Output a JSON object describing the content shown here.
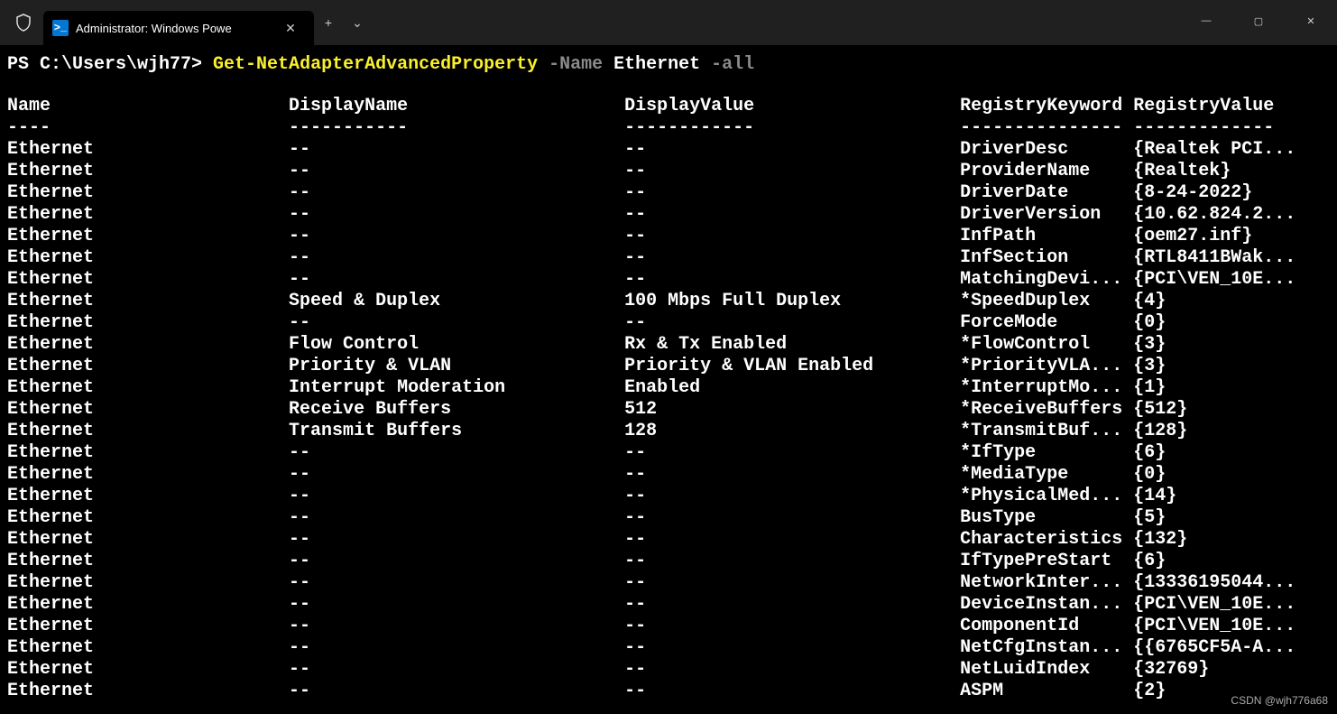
{
  "titlebar": {
    "tab_title": "Administrator: Windows Powe",
    "tab_icon_label": ">_",
    "add_label": "+",
    "chevron_label": "⌄",
    "close_tab_label": "✕",
    "minimize": "—",
    "maximize": "▢",
    "close": "✕"
  },
  "command": {
    "prompt": "PS C:\\Users\\wjh77> ",
    "cmd": "Get-NetAdapterAdvancedProperty",
    "flag1": " -Name",
    "arg1": " Ethernet",
    "flag2": " -all"
  },
  "columns": [
    "Name",
    "DisplayName",
    "DisplayValue",
    "RegistryKeyword",
    "RegistryValue"
  ],
  "widths": [
    26,
    31,
    31,
    16,
    20
  ],
  "rows": [
    {
      "Name": "Ethernet",
      "DisplayName": "--",
      "DisplayValue": "--",
      "RegistryKeyword": "DriverDesc",
      "RegistryValue": "{Realtek PCI..."
    },
    {
      "Name": "Ethernet",
      "DisplayName": "--",
      "DisplayValue": "--",
      "RegistryKeyword": "ProviderName",
      "RegistryValue": "{Realtek}"
    },
    {
      "Name": "Ethernet",
      "DisplayName": "--",
      "DisplayValue": "--",
      "RegistryKeyword": "DriverDate",
      "RegistryValue": "{8-24-2022}"
    },
    {
      "Name": "Ethernet",
      "DisplayName": "--",
      "DisplayValue": "--",
      "RegistryKeyword": "DriverVersion",
      "RegistryValue": "{10.62.824.2..."
    },
    {
      "Name": "Ethernet",
      "DisplayName": "--",
      "DisplayValue": "--",
      "RegistryKeyword": "InfPath",
      "RegistryValue": "{oem27.inf}"
    },
    {
      "Name": "Ethernet",
      "DisplayName": "--",
      "DisplayValue": "--",
      "RegistryKeyword": "InfSection",
      "RegistryValue": "{RTL8411BWak..."
    },
    {
      "Name": "Ethernet",
      "DisplayName": "--",
      "DisplayValue": "--",
      "RegistryKeyword": "MatchingDevi...",
      "RegistryValue": "{PCI\\VEN_10E..."
    },
    {
      "Name": "Ethernet",
      "DisplayName": "Speed & Duplex",
      "DisplayValue": "100 Mbps Full Duplex",
      "RegistryKeyword": "*SpeedDuplex",
      "RegistryValue": "{4}"
    },
    {
      "Name": "Ethernet",
      "DisplayName": "--",
      "DisplayValue": "--",
      "RegistryKeyword": "ForceMode",
      "RegistryValue": "{0}"
    },
    {
      "Name": "Ethernet",
      "DisplayName": "Flow Control",
      "DisplayValue": "Rx & Tx Enabled",
      "RegistryKeyword": "*FlowControl",
      "RegistryValue": "{3}"
    },
    {
      "Name": "Ethernet",
      "DisplayName": "Priority & VLAN",
      "DisplayValue": "Priority & VLAN Enabled",
      "RegistryKeyword": "*PriorityVLA...",
      "RegistryValue": "{3}"
    },
    {
      "Name": "Ethernet",
      "DisplayName": "Interrupt Moderation",
      "DisplayValue": "Enabled",
      "RegistryKeyword": "*InterruptMo...",
      "RegistryValue": "{1}"
    },
    {
      "Name": "Ethernet",
      "DisplayName": "Receive Buffers",
      "DisplayValue": "512",
      "RegistryKeyword": "*ReceiveBuffers",
      "RegistryValue": "{512}"
    },
    {
      "Name": "Ethernet",
      "DisplayName": "Transmit Buffers",
      "DisplayValue": "128",
      "RegistryKeyword": "*TransmitBuf...",
      "RegistryValue": "{128}"
    },
    {
      "Name": "Ethernet",
      "DisplayName": "--",
      "DisplayValue": "--",
      "RegistryKeyword": "*IfType",
      "RegistryValue": "{6}"
    },
    {
      "Name": "Ethernet",
      "DisplayName": "--",
      "DisplayValue": "--",
      "RegistryKeyword": "*MediaType",
      "RegistryValue": "{0}"
    },
    {
      "Name": "Ethernet",
      "DisplayName": "--",
      "DisplayValue": "--",
      "RegistryKeyword": "*PhysicalMed...",
      "RegistryValue": "{14}"
    },
    {
      "Name": "Ethernet",
      "DisplayName": "--",
      "DisplayValue": "--",
      "RegistryKeyword": "BusType",
      "RegistryValue": "{5}"
    },
    {
      "Name": "Ethernet",
      "DisplayName": "--",
      "DisplayValue": "--",
      "RegistryKeyword": "Characteristics",
      "RegistryValue": "{132}"
    },
    {
      "Name": "Ethernet",
      "DisplayName": "--",
      "DisplayValue": "--",
      "RegistryKeyword": "IfTypePreStart",
      "RegistryValue": "{6}"
    },
    {
      "Name": "Ethernet",
      "DisplayName": "--",
      "DisplayValue": "--",
      "RegistryKeyword": "NetworkInter...",
      "RegistryValue": "{13336195044..."
    },
    {
      "Name": "Ethernet",
      "DisplayName": "--",
      "DisplayValue": "--",
      "RegistryKeyword": "DeviceInstan...",
      "RegistryValue": "{PCI\\VEN_10E..."
    },
    {
      "Name": "Ethernet",
      "DisplayName": "--",
      "DisplayValue": "--",
      "RegistryKeyword": "ComponentId",
      "RegistryValue": "{PCI\\VEN_10E..."
    },
    {
      "Name": "Ethernet",
      "DisplayName": "--",
      "DisplayValue": "--",
      "RegistryKeyword": "NetCfgInstan...",
      "RegistryValue": "{{6765CF5A-A..."
    },
    {
      "Name": "Ethernet",
      "DisplayName": "--",
      "DisplayValue": "--",
      "RegistryKeyword": "NetLuidIndex",
      "RegistryValue": "{32769}"
    },
    {
      "Name": "Ethernet",
      "DisplayName": "--",
      "DisplayValue": "--",
      "RegistryKeyword": "ASPM",
      "RegistryValue": "{2}"
    }
  ],
  "watermark": "CSDN @wjh776a68"
}
